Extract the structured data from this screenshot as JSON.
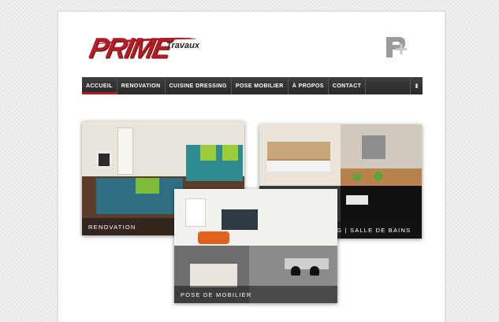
{
  "logo": {
    "brand": "PRIME",
    "sub": "Travaux",
    "mark_icon": "p-plus-logo-icon"
  },
  "nav": {
    "items": [
      {
        "label": "ACCUEIL",
        "active": true
      },
      {
        "label": "RENOVATION",
        "active": false
      },
      {
        "label": "CUISINE DRESSING",
        "active": false
      },
      {
        "label": "POSE MOBILIER",
        "active": false
      },
      {
        "label": "À PROPOS",
        "active": false
      },
      {
        "label": "CONTACT",
        "active": false
      }
    ],
    "toggle_icon": "menu-toggle-icon",
    "toggle_glyph": "⬍"
  },
  "tiles": {
    "renovation": "RENOVATION",
    "cuisine": "CUISINE | DRESSING | SALLE DE BAINS",
    "pose": "POSE DE MOBILIER"
  },
  "colors": {
    "accent": "#b01d25",
    "nav_bg": "#333333",
    "page_bg": "#ececec"
  }
}
